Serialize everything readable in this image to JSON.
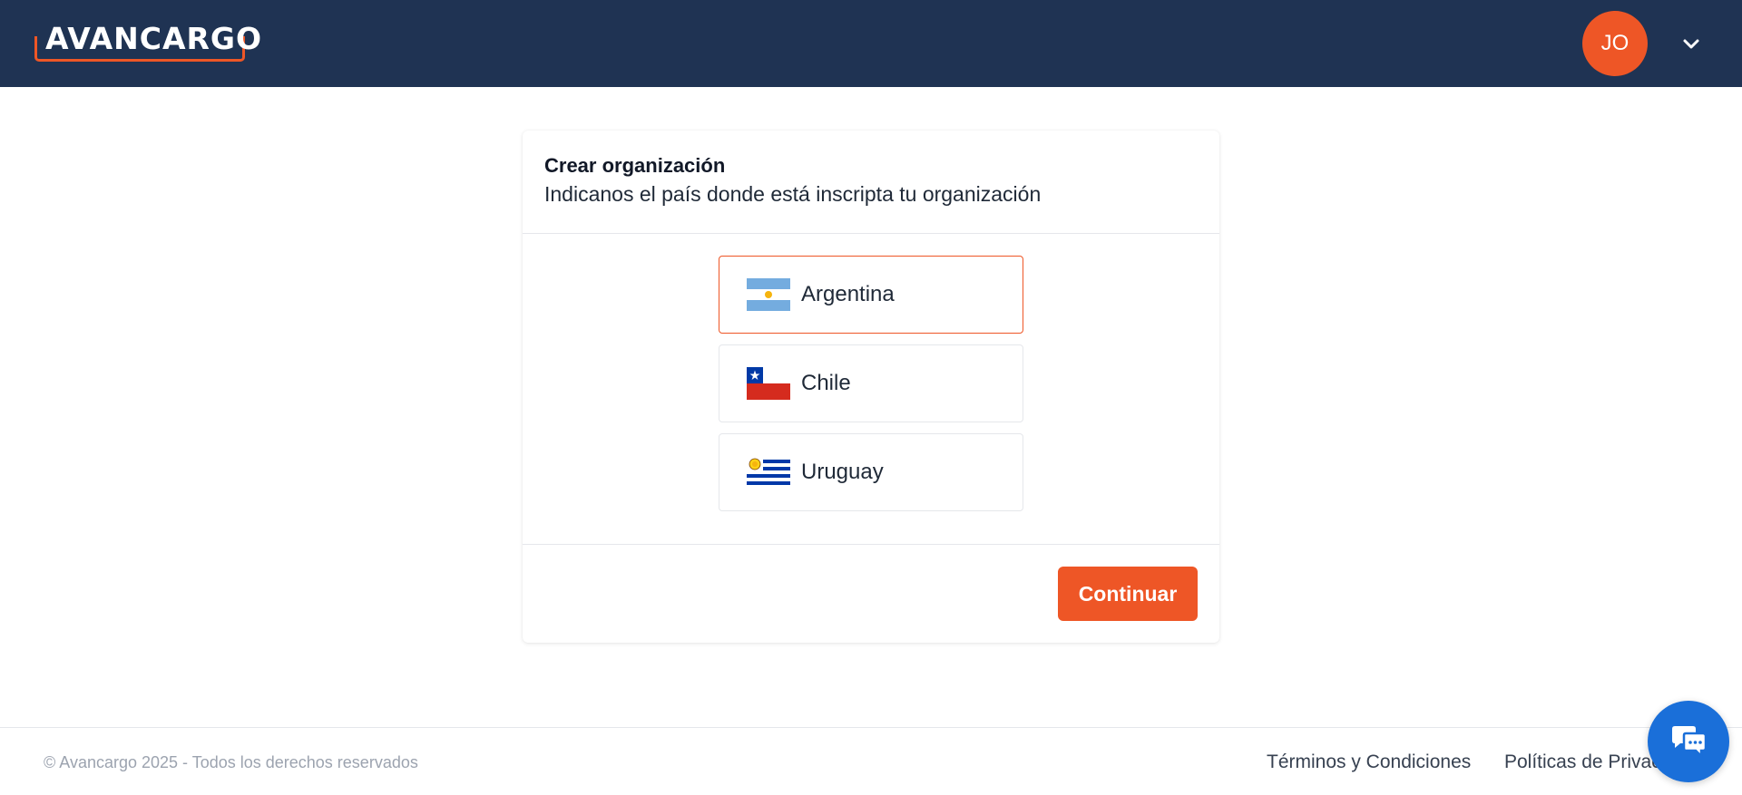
{
  "header": {
    "logo_text": "AVANCARGO",
    "avatar_initials": "JO",
    "icons": {
      "menu": "chevron-down-icon"
    },
    "colors": {
      "background": "#1f3353",
      "accent": "#ee5626"
    }
  },
  "card": {
    "title": "Crear organización",
    "subtitle": "Indicanos el país donde está inscripta tu organización",
    "options": [
      {
        "label": "Argentina",
        "flag": "argentina-flag-icon",
        "selected": true
      },
      {
        "label": "Chile",
        "flag": "chile-flag-icon",
        "selected": false
      },
      {
        "label": "Uruguay",
        "flag": "uruguay-flag-icon",
        "selected": false
      }
    ],
    "continue_label": "Continuar"
  },
  "footer": {
    "copyright": "© Avancargo 2025 - Todos los derechos reservados",
    "terms_label": "Términos y Condiciones",
    "privacy_label": "Políticas de Privacidad"
  },
  "chat": {
    "icon": "chat-bubble-icon",
    "color": "#1a6fd9"
  }
}
